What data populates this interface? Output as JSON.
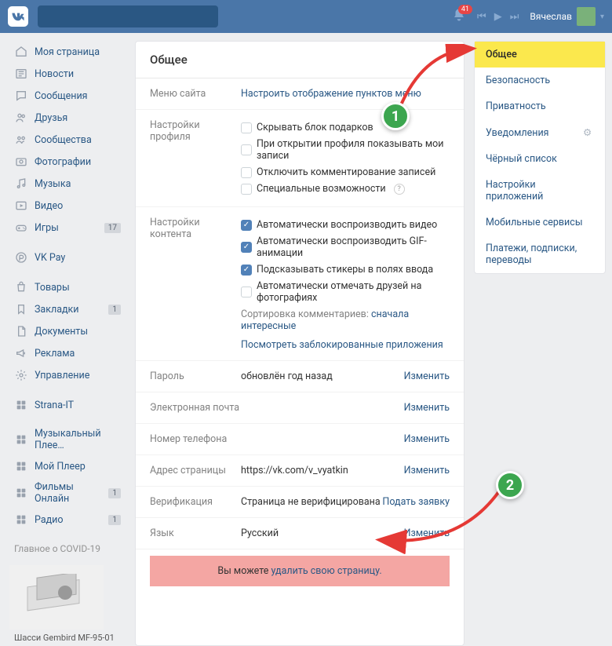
{
  "header": {
    "username": "Вячеслав",
    "bell_count": "41"
  },
  "leftnav": {
    "items": [
      {
        "icon": "home",
        "label": "Моя страница"
      },
      {
        "icon": "news",
        "label": "Новости"
      },
      {
        "icon": "msg",
        "label": "Сообщения"
      },
      {
        "icon": "friends",
        "label": "Друзья"
      },
      {
        "icon": "groups",
        "label": "Сообщества"
      },
      {
        "icon": "photo",
        "label": "Фотографии"
      },
      {
        "icon": "music",
        "label": "Музыка"
      },
      {
        "icon": "video",
        "label": "Видео"
      },
      {
        "icon": "games",
        "label": "Игры",
        "badge": "17"
      }
    ],
    "pay": {
      "icon": "pay",
      "label": "VK Pay"
    },
    "items2": [
      {
        "icon": "shop",
        "label": "Товары"
      },
      {
        "icon": "bookmark",
        "label": "Закладки",
        "badge": "1"
      },
      {
        "icon": "docs",
        "label": "Документы"
      },
      {
        "icon": "ads",
        "label": "Реклама"
      },
      {
        "icon": "manage",
        "label": "Управление"
      }
    ],
    "items3": [
      {
        "icon": "app",
        "label": "Strana-IT"
      }
    ],
    "items4": [
      {
        "icon": "app",
        "label": "Музыкальный Плее…"
      },
      {
        "icon": "app",
        "label": "Мой Плеер"
      },
      {
        "icon": "app",
        "label": "Фильмы Онлайн",
        "badge": "1"
      },
      {
        "icon": "app",
        "label": "Радио",
        "badge": "1"
      }
    ],
    "covid": "Главное о COVID-19",
    "ad_title": "Шасси Gembird MF-95-01"
  },
  "main": {
    "title": "Общее",
    "menu_site": {
      "label": "Меню сайта",
      "action": "Настроить отображение пунктов меню"
    },
    "profile": {
      "label": "Настройки профиля",
      "opts": [
        {
          "checked": false,
          "text": "Скрывать блок подарков"
        },
        {
          "checked": false,
          "text": "При открытии профиля показывать мои записи"
        },
        {
          "checked": false,
          "text": "Отключить комментирование записей"
        },
        {
          "checked": false,
          "text": "Специальные возможности",
          "help": true
        }
      ]
    },
    "content": {
      "label": "Настройки контента",
      "opts": [
        {
          "checked": true,
          "text": "Автоматически воспроизводить видео"
        },
        {
          "checked": true,
          "text": "Автоматически воспроизводить GIF-анимации"
        },
        {
          "checked": true,
          "text": "Подсказывать стикеры в полях ввода"
        },
        {
          "checked": false,
          "text": "Автоматически отмечать друзей на фотографиях"
        }
      ],
      "sort_label": "Сортировка комментариев:",
      "sort_value": "сначала интересные",
      "blocked": "Посмотреть заблокированные приложения"
    },
    "password": {
      "label": "Пароль",
      "value": "обновлён год назад",
      "action": "Изменить"
    },
    "email": {
      "label": "Электронная почта",
      "value": "",
      "action": "Изменить"
    },
    "phone": {
      "label": "Номер телефона",
      "value": "",
      "action": "Изменить"
    },
    "address": {
      "label": "Адрес страницы",
      "value": "https://vk.com/v_vyatkin",
      "action": "Изменить"
    },
    "verification": {
      "label": "Верификация",
      "value": "Страница не верифицирована",
      "action": "Подать заявку"
    },
    "lang": {
      "label": "Язык",
      "value": "Русский",
      "action": "Изменить"
    },
    "delete_prefix": "Вы можете ",
    "delete_link": "удалить свою страницу."
  },
  "rightnav": {
    "items": [
      "Общее",
      "Безопасность",
      "Приватность",
      "Уведомления",
      "Чёрный список",
      "Настройки приложений",
      "Мобильные сервисы",
      "Платежи, подписки, переводы"
    ],
    "gear_index": 3
  },
  "annotations": {
    "a1": "1",
    "a2": "2"
  },
  "colors": {
    "brand": "#4a76a8",
    "link": "#2a5885",
    "highlight": "#fbe84d",
    "danger_bg": "#f4a6a3"
  }
}
